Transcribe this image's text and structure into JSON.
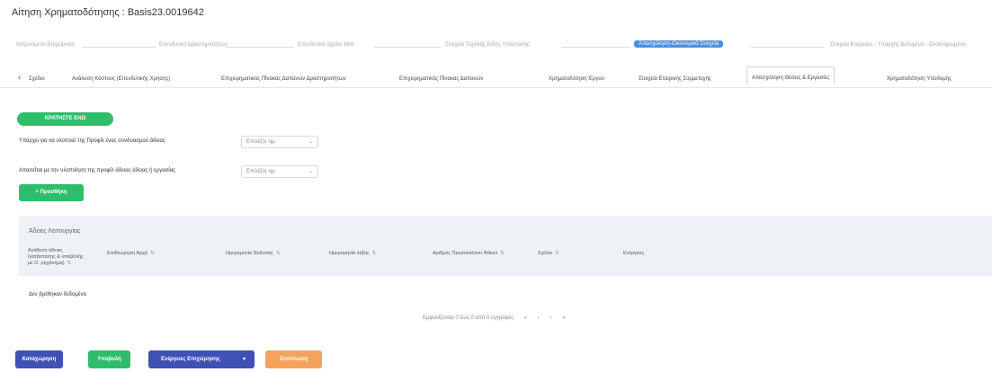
{
  "header": {
    "title": "Αίτηση Χρηματοδότησης : Basis23.0019642"
  },
  "steps": [
    {
      "label": "Ιαπωνόμενο Επιχείρηση",
      "active": false
    },
    {
      "label": "Επενδυτικό Δραστηριοτήτων",
      "active": false
    },
    {
      "label": "Επενδυτικό σχέδιο Μεθ.",
      "active": false
    },
    {
      "label": "Στοιχεία Τεχνικής Ειδής Υπόστασης",
      "active": false
    },
    {
      "label": "Απασχόληση-Οικονομικά Στοιχεία",
      "active": true
    },
    {
      "label": "Στοιχεία Εταιρείας - Υπάρχης Δεδομένα - Ολοκληρωμένα",
      "active": false
    }
  ],
  "tabs": {
    "back": "Σχέδιο",
    "items": [
      "Ανάλυση Κόστους (Επενδυτικής Χρήσης)",
      "Επιχειρηματικός Πίνακας Δαπανών Δραστηριοτήτων",
      "Επιχειρηματικός Πίνακας Δαπανών",
      "Χρηματοδότηση Έργου",
      "Στοιχεία Εταιρικής Συμμετοχής",
      "Απασχόληση Θέσεις & Εργασίες",
      "Χρηματοδότηση Υποδομής"
    ],
    "active_index": 5
  },
  "actions": {
    "create_label": "ΚΡΑΤΗΣΤΕ ΕΝΩ",
    "q1": "Υπάρχει για να υλοποιεί της Προφίλ ένας συνδυασμού άδειας",
    "q1_select": "Επιλέξτε ημ.",
    "q2": "Απαιτείται με την υλοποίηση της προφίλ άδειας άδειας ή εργασίας",
    "q2_select": "Επιλέξτε ημ.",
    "add_label": "+ Προσθήκη"
  },
  "table": {
    "title": "Άδειες Λειτουργίας",
    "headers": [
      "Ανάθεση άδειας (κατάστασης & υποβολής με Ο. μηχάνημα)",
      "Επιθεώρηση Αρχή",
      "Ημερομηνία Έκδοσης",
      "Ημερομηνία λήξης",
      "Αριθμός Πρωτοκόλλου Φάκελ",
      "Σχόλιο",
      "Ενέργειες"
    ],
    "empty_text": "Δεν βρέθηκαν δεδομένα"
  },
  "pager": {
    "summary": "Εμφανίζονται 0 έως 0 από 0 εγγραφές",
    "controls": [
      "«",
      "‹",
      "›",
      "»"
    ]
  },
  "footer": {
    "btn1": "Καταχώρηση",
    "btn2": "Υποβολή",
    "btn3": "Ενέργειες Επιχείρησης",
    "btn4": "Εκτύπωση"
  },
  "colors": {
    "green": "#2ebd6b",
    "blue": "#3f51b5",
    "orange": "#f5a35c",
    "active_step": "#4a90e2"
  }
}
